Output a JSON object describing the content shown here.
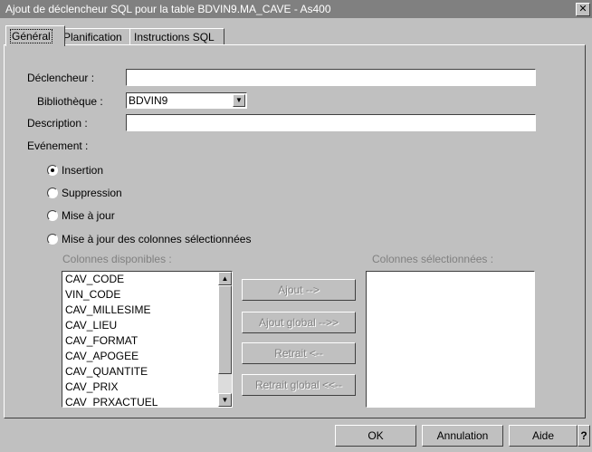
{
  "window": {
    "title": "Ajout de déclencheur SQL pour la table BDVIN9.MA_CAVE    - As400",
    "close_glyph": "✕"
  },
  "tabs": [
    {
      "label": "Général"
    },
    {
      "label": "Planification"
    },
    {
      "label": "Instructions SQL"
    }
  ],
  "form": {
    "declencheur_label": "Déclencheur :",
    "declencheur_value": "",
    "bibliotheque_label": "Bibliothèque :",
    "bibliotheque_value": "BDVIN9",
    "description_label": "Description :",
    "description_value": "",
    "evenement_label": "Evénement :"
  },
  "events": [
    {
      "label": "Insertion",
      "checked": true
    },
    {
      "label": "Suppression",
      "checked": false
    },
    {
      "label": "Mise à jour",
      "checked": false
    },
    {
      "label": "Mise à jour des colonnes sélectionnées",
      "checked": false
    }
  ],
  "columns": {
    "available_label": "Colonnes disponibles :",
    "selected_label": "Colonnes sélectionnées :",
    "available": [
      "CAV_CODE",
      "VIN_CODE",
      "CAV_MILLESIME",
      "CAV_LIEU",
      "CAV_FORMAT",
      "CAV_APOGEE",
      "CAV_QUANTITE",
      "CAV_PRIX",
      "CAV_PRXACTUEL"
    ],
    "selected": []
  },
  "transfer_buttons": {
    "add": "Ajout -->",
    "add_all": "Ajout global -->>",
    "remove": "Retrait <--",
    "remove_all": "Retrait global <<--"
  },
  "footer": {
    "ok": "OK",
    "cancel": "Annulation",
    "help": "Aide",
    "question": "?"
  }
}
